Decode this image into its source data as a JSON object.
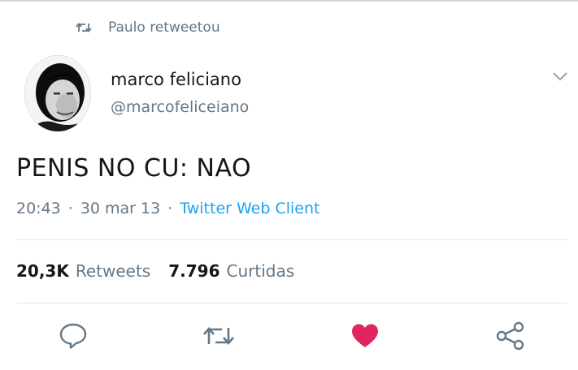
{
  "retweet_context": {
    "text": "Paulo retweetou",
    "icon": "retweet-icon"
  },
  "author": {
    "name": "marco feliciano",
    "handle": "@marcofeliceiano",
    "avatar": "avatar-photo"
  },
  "tweet": {
    "text": "PENIS NO CU: NAO"
  },
  "meta": {
    "time": "20:43",
    "sep1": "·",
    "date": "30 mar 13",
    "sep2": "·",
    "client": "Twitter Web Client"
  },
  "stats": {
    "retweets_count": "20,3K",
    "retweets_label": "Retweets",
    "likes_count": "7.796",
    "likes_label": "Curtidas"
  },
  "actions": {
    "reply": "reply-icon",
    "retweet": "retweet-icon",
    "like": "heart-icon",
    "share": "share-icon",
    "like_color": "#e0245e"
  },
  "colors": {
    "accent": "#1da1f2",
    "secondary": "#657786",
    "text": "#14171a"
  }
}
